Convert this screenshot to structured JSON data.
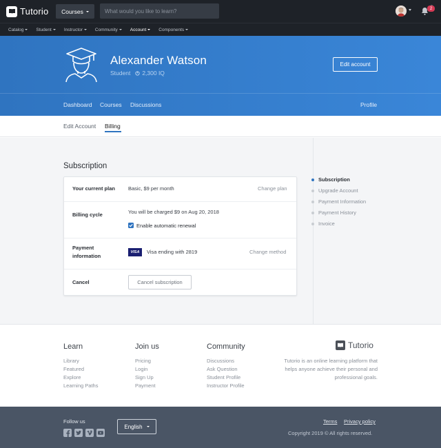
{
  "brand": {
    "name": "Tutorio"
  },
  "topbar": {
    "courses_label": "Courses",
    "search_placeholder": "What would you like to learn?",
    "notification_count": "2"
  },
  "subnav": [
    {
      "label": "Catalog",
      "dropdown": true
    },
    {
      "label": "Student",
      "dropdown": true
    },
    {
      "label": "Instructor",
      "dropdown": true
    },
    {
      "label": "Community",
      "dropdown": true
    },
    {
      "label": "Account",
      "dropdown": true,
      "active": true
    },
    {
      "label": "Components",
      "dropdown": true
    }
  ],
  "profile": {
    "name": "Alexander Watson",
    "role": "Student",
    "iq": "2,300 IQ",
    "edit_button": "Edit account"
  },
  "hero_tabs": {
    "dashboard": "Dashboard",
    "courses": "Courses",
    "discussions": "Discussions",
    "profile": "Profile"
  },
  "section_tabs": {
    "edit_account": "Edit Account",
    "billing": "Billing"
  },
  "subscription": {
    "heading": "Subscription",
    "current_plan": {
      "label": "Your current plan",
      "value": "Basic, $9 per month",
      "action": "Change plan"
    },
    "billing_cycle": {
      "label": "Billing cycle",
      "value": "You will be charged $9 on Aug 20, 2018",
      "auto_renew_label": "Enable automatic renewal",
      "auto_renew_checked": true
    },
    "payment_info": {
      "label_line1": "Payment",
      "label_line2": "information",
      "card_brand": "VISA",
      "value": "Visa ending with 2819",
      "action": "Change method"
    },
    "cancel": {
      "label": "Cancel",
      "button": "Cancel subscription"
    }
  },
  "sidebar": [
    {
      "label": "Subscription",
      "active": true
    },
    {
      "label": "Upgrade Account",
      "active": false
    },
    {
      "label": "Payment Information",
      "active": false
    },
    {
      "label": "Payment History",
      "active": false
    },
    {
      "label": "Invoice",
      "active": false
    }
  ],
  "footer": {
    "learn": {
      "heading": "Learn",
      "links": [
        "Library",
        "Featured",
        "Explore",
        "Learning Paths"
      ]
    },
    "join": {
      "heading": "Join us",
      "links": [
        "Pricing",
        "Login",
        "Sign Up",
        "Payment"
      ]
    },
    "community": {
      "heading": "Community",
      "links": [
        "Discussions",
        "Ask Question",
        "Student Profile",
        "Instructor Profile"
      ]
    },
    "description": "Tutorio is an online learning platform that helps anyone achieve their personal and professional goals.",
    "follow_us": "Follow us",
    "social_icons": [
      "facebook-icon",
      "twitter-icon",
      "vimeo-icon",
      "youtube-icon"
    ],
    "language": "English",
    "terms": "Terms",
    "privacy": "Privacy policy",
    "copyright": "Copyright 2019 © All rights reserved."
  },
  "colors": {
    "topbar": "#1e2228",
    "hero": "#2f74c0",
    "accent": "#2f74c0",
    "footer_bottom": "#4a5565",
    "badge": "#d63a55"
  }
}
